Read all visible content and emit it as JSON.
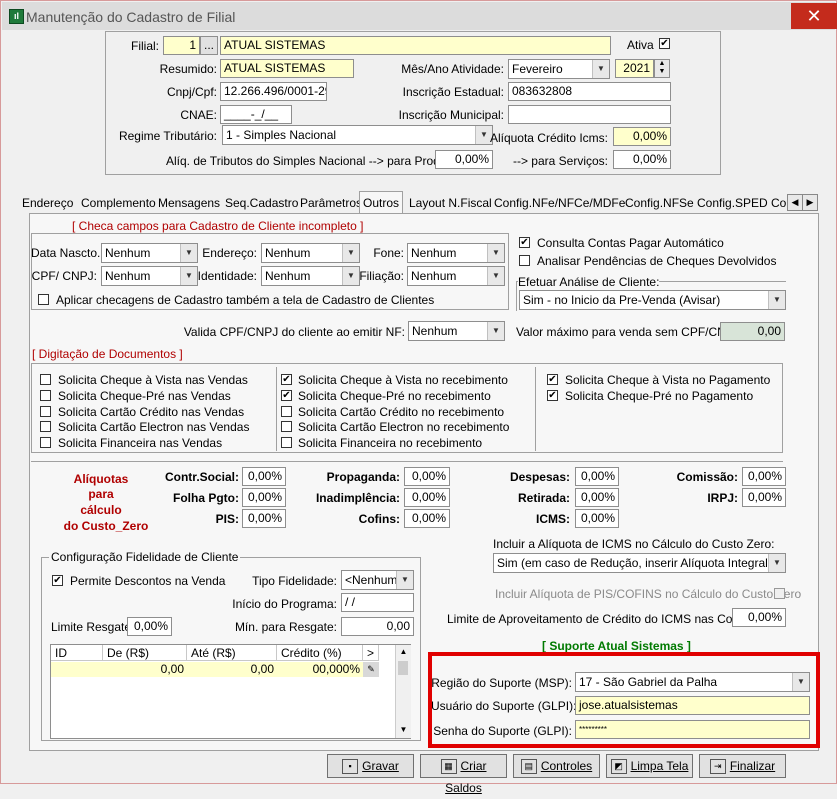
{
  "window": {
    "title": "Manutenção do Cadastro de Filial",
    "close": "✕"
  },
  "header": {
    "filial_label": "Filial:",
    "filial_code": "1",
    "filial_lookup": "...",
    "filial_name": "ATUAL SISTEMAS",
    "ativa_label": "Ativa",
    "ativa_checked": "✔",
    "resumido_label": "Resumido:",
    "resumido": "ATUAL SISTEMAS",
    "mes_ano_label": "Mês/Ano Atividade:",
    "mes": "Fevereiro",
    "ano": "2021",
    "cnpj_label": "Cnpj/Cpf:",
    "cnpj": "12.266.496/0001-29",
    "ie_label": "Inscrição Estadual:",
    "ie": "083632808",
    "cnae_label": "CNAE:",
    "cnae": "____-_/__",
    "im_label": "Inscrição Municipal:",
    "im": "",
    "regime_label": "Regime Tributário:",
    "regime": "1 - Simples Nacional",
    "aliq_icms_label": "Alíquota Crédito Icms:",
    "aliq_icms": "0,00%",
    "aliq_simples_label": "Alíq. de Tributos do Simples Nacional  --> para Produtos:",
    "aliq_produtos": "0,00%",
    "servicos_label": "--> para Serviços:",
    "aliq_servicos": "0,00%"
  },
  "tabs": [
    "Endereço",
    "Complemento",
    "Mensagens",
    "Seq.Cadastro",
    "Parâmetros",
    "Outros",
    "Layout N.Fiscal",
    "Config.NFe/NFCe/MDFe",
    "Config.NFSe",
    "Config.SPED",
    "Cor"
  ],
  "checa": {
    "title": "[  Checa campos para Cadastro de Cliente incompleto  ]",
    "data_nasc_label": "Data Nascto.:",
    "data_nasc": "Nenhum",
    "endereco_label": "Endereço:",
    "endereco": "Nenhum",
    "fone_label": "Fone:",
    "fone": "Nenhum",
    "cpf_label": "CPF/ CNPJ:",
    "cpf": "Nenhum",
    "identidade_label": "Identidade:",
    "identidade": "Nenhum",
    "filiacao_label": "Filiação:",
    "filiacao": "Nenhum",
    "aplicar_label": "Aplicar checagens de Cadastro também a tela de Cadastro de Clientes"
  },
  "right_opts": {
    "consulta_label": "Consulta Contas Pagar Automático",
    "analisar_label": "Analisar Pendências de Cheques Devolvidos",
    "efetuar_label": "Efetuar Análise de Cliente:",
    "efetuar": "Sim - no Inicio da Pre-Venda (Avisar)"
  },
  "valida": {
    "label": "Valida CPF/CNPJ do cliente ao emitir NF:",
    "value": "Nenhum",
    "valor_max_label": "Valor máximo para venda sem CPF/CNPJ:",
    "valor_max": "0,00"
  },
  "digitacao": {
    "title": "[  Digitação de Documentos  ]",
    "col1": [
      "Solicita Cheque à Vista nas Vendas",
      "Solicita Cheque-Pré nas Vendas",
      "Solicita Cartão Crédito nas Vendas",
      "Solicita Cartão Electron nas Vendas",
      "Solicita Financeira nas Vendas"
    ],
    "col2": [
      "Solicita Cheque à Vista no recebimento",
      "Solicita Cheque-Pré no recebimento",
      "Solicita Cartão Crédito no recebimento",
      "Solicita Cartão Electron no recebimento",
      "Solicita Financeira no recebimento"
    ],
    "col3": [
      "Solicita Cheque à Vista no Pagamento",
      "Solicita Cheque-Pré no Pagamento"
    ],
    "check_mark": "✔"
  },
  "aliquotas": {
    "title1": "Alíquotas",
    "title2": "para",
    "title3": "cálculo",
    "title4": "do Custo_Zero",
    "contr_social_label": "Contr.Social:",
    "contr_social": "0,00%",
    "folha_label": "Folha Pgto:",
    "folha": "0,00%",
    "pis_label": "PIS:",
    "pis": "0,00%",
    "propaganda_label": "Propaganda:",
    "propaganda": "0,00%",
    "inadimplencia_label": "Inadimplência:",
    "inadimplencia": "0,00%",
    "cofins_label": "Cofins:",
    "cofins": "0,00%",
    "despesas_label": "Despesas:",
    "despesas": "0,00%",
    "retirada_label": "Retirada:",
    "retirada": "0,00%",
    "icms_label": "ICMS:",
    "icms": "0,00%",
    "comissao_label": "Comissão:",
    "comissao": "0,00%",
    "irpj_label": "IRPJ:",
    "irpj": "0,00%"
  },
  "fidelidade": {
    "title": "Configuração Fidelidade de Cliente",
    "permite_label": "Permite Descontos na Venda",
    "tipo_label": "Tipo Fidelidade:",
    "tipo": "<Nenhum>",
    "inicio_label": "Início do Programa:",
    "inicio": " /  /",
    "limite_label": "Limite Resgate:",
    "limite": "0,00%",
    "min_label": "Mín. para Resgate:",
    "min": "0,00",
    "grid_headers": [
      "ID",
      "De (R$)",
      "Até (R$)",
      "Crédito (%)",
      ">"
    ],
    "grid_row": [
      "",
      "0,00",
      "0,00",
      "00,000%"
    ]
  },
  "icms_custo": {
    "incluir_label": "Incluir a Alíquota de ICMS no Cálculo do Custo Zero:",
    "incluir": "Sim (em caso de Redução, inserir Alíquota Integral)",
    "pis_cofins_label": "Incluir Alíquota de PIS/COFINS no Cálculo do Custo Zero",
    "limite_aprov_label": "Limite de Aproveitamento de Crédito do ICMS nas Compras:",
    "limite_aprov": "0,00%"
  },
  "suporte": {
    "title": "[  Suporte Atual Sistemas  ]",
    "regiao_label": "Região do Suporte (MSP):",
    "regiao": "17 - São Gabriel da Palha",
    "usuario_label": "Usuário do Suporte (GLPI):",
    "usuario": "jose.atualsistemas",
    "senha_label": "Senha do Suporte (GLPI):",
    "senha": "*********"
  },
  "buttons": {
    "gravar": "Gravar",
    "criar_saldos": "Criar Saldos",
    "controles": "Controles",
    "limpa_tela": "Limpa Tela",
    "finalizar": "Finalizar"
  },
  "colors": {
    "accent_red": "#e00000",
    "header_red": "#b00000",
    "support_green": "#007a00",
    "field_yellow": "#ffffcc"
  }
}
